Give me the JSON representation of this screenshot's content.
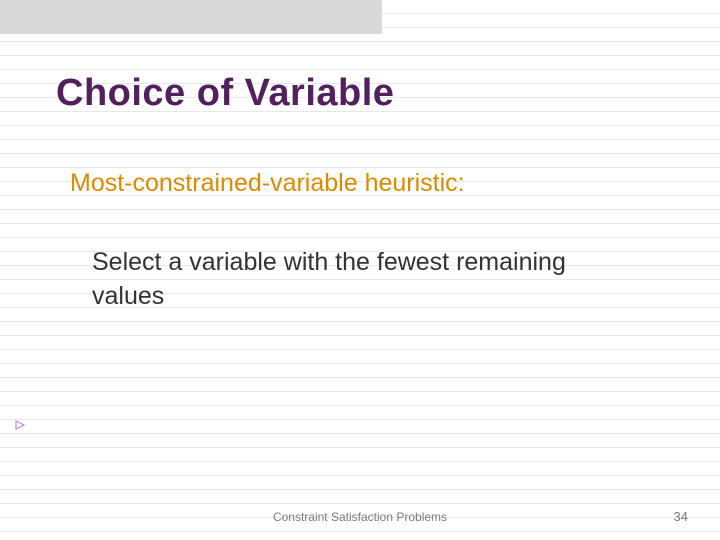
{
  "slide": {
    "title": "Choice of Variable",
    "heuristic": "Most-constrained-variable heuristic:",
    "body": "Select a variable with the fewest remaining values",
    "footer": "Constraint Satisfaction Problems",
    "page": "34"
  }
}
